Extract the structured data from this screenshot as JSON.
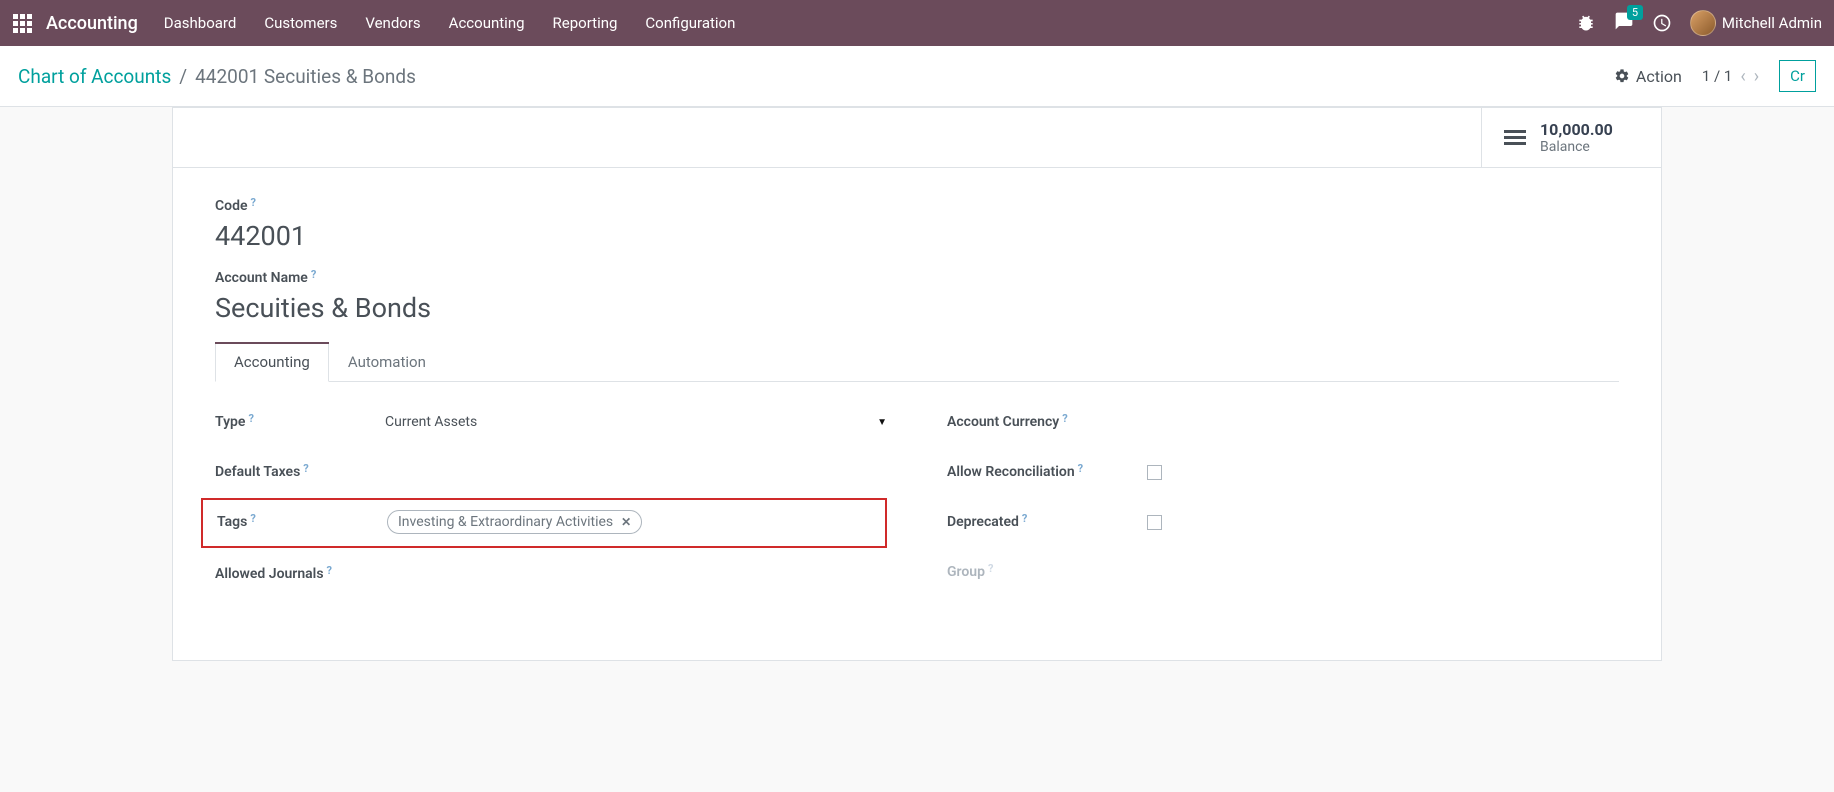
{
  "topbar": {
    "brand": "Accounting",
    "nav": [
      "Dashboard",
      "Customers",
      "Vendors",
      "Accounting",
      "Reporting",
      "Configuration"
    ],
    "msg_count": "5",
    "user": "Mitchell Admin"
  },
  "breadcrumb": {
    "root": "Chart of Accounts",
    "current": "442001 Secuities & Bonds"
  },
  "controls": {
    "action": "Action",
    "pager": "1 / 1",
    "create": "Cr"
  },
  "stat": {
    "value": "10,000.00",
    "label": "Balance"
  },
  "form": {
    "code_label": "Code",
    "code_value": "442001",
    "name_label": "Account Name",
    "name_value": "Secuities & Bonds",
    "tabs": [
      "Accounting",
      "Automation"
    ],
    "left": {
      "type_label": "Type",
      "type_value": "Current Assets",
      "taxes_label": "Default Taxes",
      "tags_label": "Tags",
      "tag_value": "Investing & Extraordinary Activities",
      "journals_label": "Allowed Journals"
    },
    "right": {
      "currency_label": "Account Currency",
      "reconcile_label": "Allow Reconciliation",
      "deprecated_label": "Deprecated",
      "group_label": "Group"
    }
  }
}
